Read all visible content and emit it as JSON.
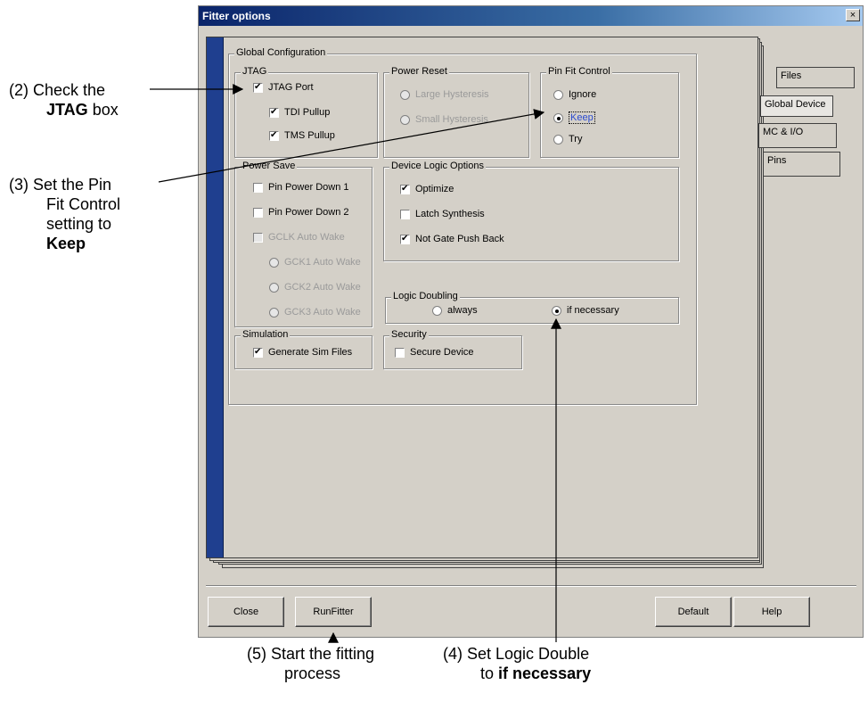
{
  "window": {
    "title": "Fitter options",
    "close_glyph": "×"
  },
  "tabs": [
    {
      "label": "Files"
    },
    {
      "label": "Global Device"
    },
    {
      "label": "MC & I/O"
    },
    {
      "label": "Pins"
    }
  ],
  "global_config": {
    "legend": "Global Configuration",
    "jtag": {
      "legend": "JTAG",
      "jtag_port": {
        "label": "JTAG Port",
        "checked": true
      },
      "tdi_pullup": {
        "label": "TDI Pullup",
        "checked": true
      },
      "tms_pullup": {
        "label": "TMS Pullup",
        "checked": true
      }
    },
    "power_reset": {
      "legend": "Power Reset",
      "large": {
        "label": "Large Hysteresis",
        "enabled": false
      },
      "small": {
        "label": "Small Hysteresis",
        "enabled": false
      }
    },
    "pin_fit": {
      "legend": "Pin Fit Control",
      "ignore": "Ignore",
      "keep": "Keep",
      "try": "Try",
      "selected": "Keep"
    },
    "power_save": {
      "legend": "Power Save",
      "ppd1": "Pin Power Down 1",
      "ppd2": "Pin Power Down 2",
      "gclk": "GCLK Auto Wake",
      "gck1": "GCK1 Auto Wake",
      "gck2": "GCK2 Auto Wake",
      "gck3": "GCK3 Auto Wake"
    },
    "device_logic": {
      "legend": "Device Logic Options",
      "optimize": {
        "label": "Optimize",
        "checked": true
      },
      "latch": {
        "label": "Latch Synthesis",
        "checked": false
      },
      "notgate": {
        "label": "Not Gate Push Back",
        "checked": true
      }
    },
    "logic_doubling": {
      "legend": "Logic Doubling",
      "always": "always",
      "if_necessary": "if necessary",
      "selected": "if necessary"
    },
    "simulation": {
      "legend": "Simulation",
      "gen_sim": {
        "label": "Generate Sim Files",
        "checked": true
      }
    },
    "security": {
      "legend": "Security",
      "secure": {
        "label": "Secure Device",
        "checked": false
      }
    }
  },
  "buttons": {
    "close": "Close",
    "runfitter": "RunFitter",
    "default": "Default",
    "help": "Help"
  },
  "annotations": {
    "a2_prefix": "(2) Check the",
    "a2_bold": "JTAG",
    "a2_suffix": "box",
    "a3_line1": "(3) Set the Pin",
    "a3_line2": "Fit Control",
    "a3_line3": "setting to",
    "a3_bold": "Keep",
    "a5_line1": "(5) Start the fitting",
    "a5_line2": "process",
    "a4_line1": "(4) Set Logic Double",
    "a4_to": "to",
    "a4_bold": "if necessary"
  }
}
